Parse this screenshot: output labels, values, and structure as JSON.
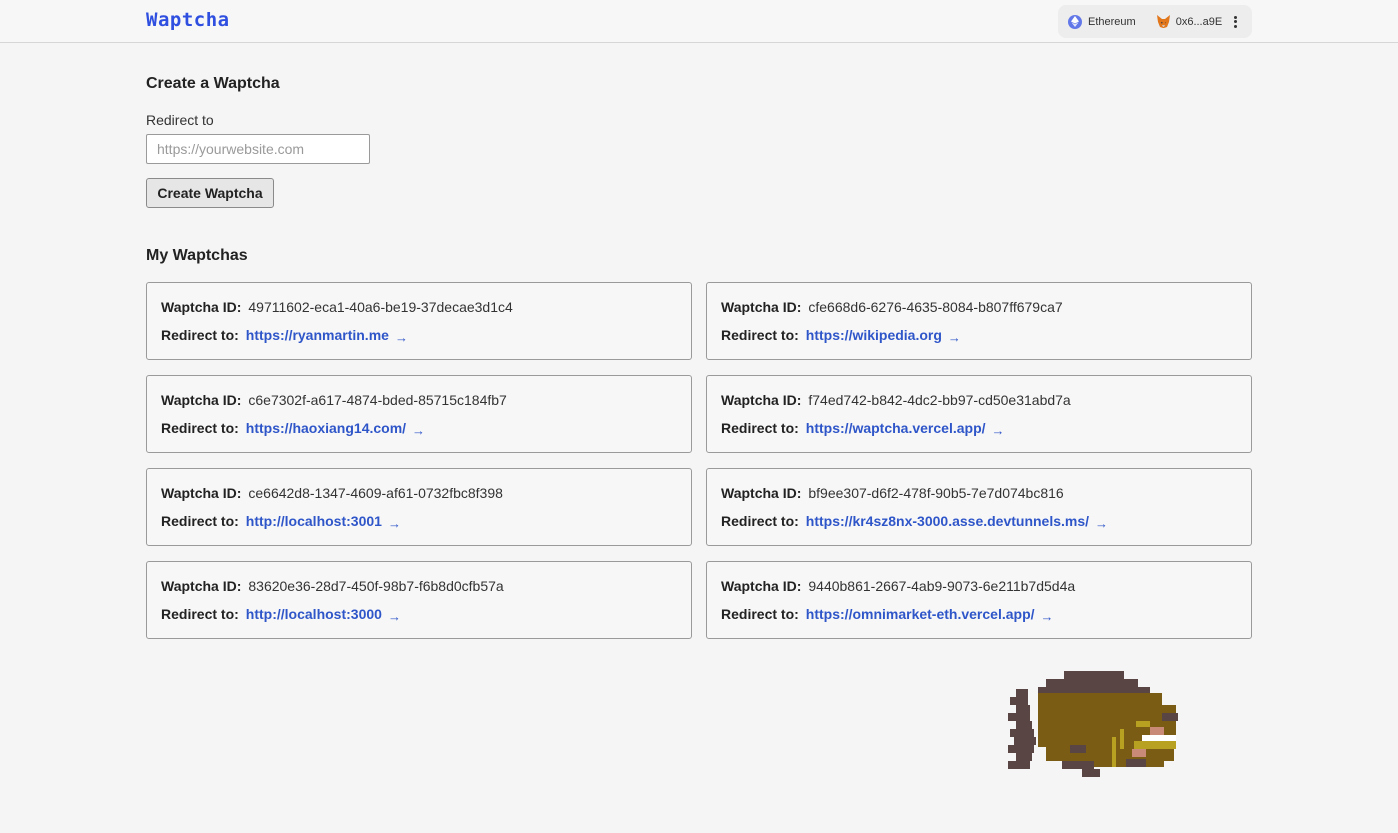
{
  "header": {
    "logo": "Waptcha",
    "network": "Ethereum",
    "account": "0x6...a9E"
  },
  "create": {
    "title": "Create a Waptcha",
    "redirect_label": "Redirect to",
    "redirect_placeholder": "https://yourwebsite.com",
    "redirect_value": "",
    "button_label": "Create Waptcha"
  },
  "list": {
    "title": "My Waptchas",
    "id_label": "Waptcha ID:",
    "redirect_label": "Redirect to:",
    "arrow": "→",
    "items": [
      {
        "id": "49711602-eca1-40a6-be19-37decae3d1c4",
        "url": "https://ryanmartin.me"
      },
      {
        "id": "cfe668d6-6276-4635-8084-b807ff679ca7",
        "url": "https://wikipedia.org"
      },
      {
        "id": "c6e7302f-a617-4874-bded-85715c184fb7",
        "url": "https://haoxiang14.com/"
      },
      {
        "id": "f74ed742-b842-4dc2-bb97-cd50e31abd7a",
        "url": "https://waptcha.vercel.app/"
      },
      {
        "id": "ce6642d8-1347-4609-af61-0732fbc8f398",
        "url": "http://localhost:3001"
      },
      {
        "id": "bf9ee307-d6f2-478f-90b5-7e7d074bc816",
        "url": "https://kr4sz8nx-3000.asse.devtunnels.ms/"
      },
      {
        "id": "83620e36-28d7-450f-98b7-f6b8d0cfb57a",
        "url": "http://localhost:3000"
      },
      {
        "id": "9440b861-2667-4ab9-9073-6e211b7d5d4a",
        "url": "https://omnimarket-eth.vercel.app/"
      }
    ]
  },
  "colors": {
    "accent": "#2f4fe0",
    "link": "#2f56c9",
    "ethereum": "#6278e8"
  },
  "icons": {
    "network": "ethereum-icon",
    "wallet": "metamask-fox-icon",
    "menu": "more-vertical-icon",
    "mascot": "pixel-fish-mascot"
  }
}
